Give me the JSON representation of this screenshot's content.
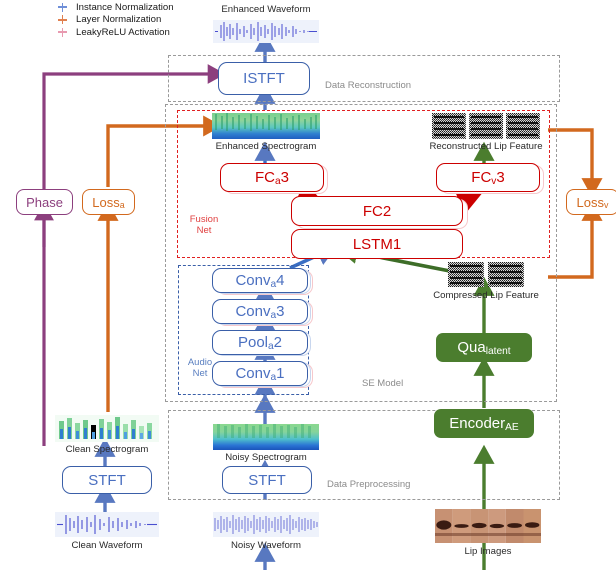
{
  "legend": {
    "items": [
      {
        "label": "Instance Normalization",
        "color": "#6f8fd8",
        "icon": "four-point-star-icon"
      },
      {
        "label": "Layer Normalization",
        "color": "#e08050",
        "icon": "four-point-star-icon"
      },
      {
        "label": "LeakyReLU Activation",
        "color": "#e89ab0",
        "icon": "four-point-star-icon"
      }
    ]
  },
  "groups": {
    "data_reconstruction": {
      "label": "Data Reconstruction"
    },
    "se_model": {
      "label": "SE Model"
    },
    "fusion_net": {
      "label": "Fusion\nNet",
      "color": "#e04040"
    },
    "audio_net": {
      "label": "Audio\nNet",
      "color": "#5a7fc0"
    },
    "data_preprocessing": {
      "label": "Data Preprocessing"
    }
  },
  "nodes": {
    "istft": {
      "label": "ISTFT"
    },
    "fc_a3": {
      "label": "FC",
      "sub": "a",
      "tail": "3"
    },
    "fc_v3": {
      "label": "FC",
      "sub": "v",
      "tail": "3"
    },
    "fc2": {
      "label": "FC2"
    },
    "lstm1": {
      "label": "LSTM1"
    },
    "conv_a4": {
      "label": "Conv",
      "sub": "a",
      "tail": "4"
    },
    "conv_a3": {
      "label": "Conv",
      "sub": "a",
      "tail": "3"
    },
    "pool_a2": {
      "label": "Pool",
      "sub": "a",
      "tail": "2"
    },
    "conv_a1": {
      "label": "Conv",
      "sub": "a",
      "tail": "1"
    },
    "qua_latent": {
      "label": "Qua",
      "sub": "latent",
      "tail": ""
    },
    "encoder_ae": {
      "label": "Encoder",
      "sub": "AE",
      "tail": ""
    },
    "stft_clean": {
      "label": "STFT"
    },
    "stft_noisy": {
      "label": "STFT"
    },
    "phase": {
      "label": "Phase"
    },
    "loss_a": {
      "label": "Loss",
      "sub": "a",
      "tail": ""
    },
    "loss_v": {
      "label": "Loss",
      "sub": "v",
      "tail": ""
    }
  },
  "captions": {
    "enhanced_waveform": "Enhanced Waveform",
    "enhanced_spectrogram": "Enhanced Spectrogram",
    "reconstructed_lip_feature": "Reconstructed Lip Feature",
    "compressed_lip_feature": "Compressed Lip Feature",
    "clean_spectrogram": "Clean Spectrogram",
    "noisy_spectrogram": "Noisy Spectrogram",
    "clean_waveform": "Clean Waveform",
    "noisy_waveform": "Noisy Waveform",
    "lip_images": "Lip Images"
  },
  "colors": {
    "blue": "#3a5fa8",
    "red": "#cc0000",
    "green": "#4b7d2e",
    "orange": "#d2691e",
    "purple": "#8c3f7e",
    "gray_dash": "#9a9a9a"
  }
}
